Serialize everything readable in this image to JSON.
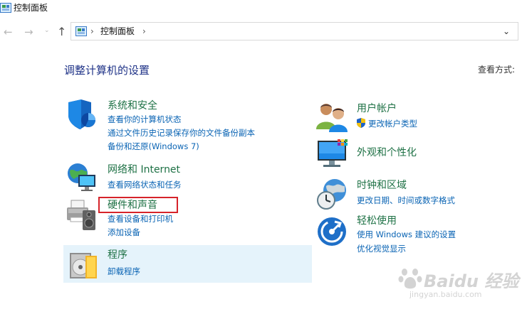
{
  "window": {
    "title": "控制面板",
    "icon": "control-panel-icon"
  },
  "address_bar": {
    "back_icon": "←",
    "forward_icon": "→",
    "recent_icon": "⌄",
    "up_icon": "↑",
    "separator": "›",
    "breadcrumb": "控制面板",
    "dropdown_icon": "⌄"
  },
  "page": {
    "title": "调整计算机的设置",
    "view_by_label": "查看方式:"
  },
  "categories_left": [
    {
      "title": "系统和安全",
      "icon": "shield-icon",
      "links": [
        "查看你的计算机状态",
        "通过文件历史记录保存你的文件备份副本",
        "备份和还原(Windows 7)"
      ]
    },
    {
      "title": "网络和 Internet",
      "icon": "network-globe-icon",
      "links": [
        "查看网络状态和任务"
      ]
    },
    {
      "title": "硬件和声音",
      "icon": "printer-speaker-icon",
      "links": [
        "查看设备和打印机",
        "添加设备"
      ]
    },
    {
      "title": "程序",
      "icon": "programs-disc-icon",
      "links": [
        "卸载程序"
      ]
    }
  ],
  "categories_right": [
    {
      "title": "用户帐户",
      "icon": "users-icon",
      "links": [
        "更改帐户类型"
      ]
    },
    {
      "title": "外观和个性化",
      "icon": "monitor-palette-icon",
      "links": []
    },
    {
      "title": "时钟和区域",
      "icon": "clock-globe-icon",
      "links": [
        "更改日期、时间或数字格式"
      ]
    },
    {
      "title": "轻松使用",
      "icon": "ease-of-access-icon",
      "links": [
        "使用 Windows 建议的设置",
        "优化视觉显示"
      ]
    }
  ],
  "watermark": {
    "text": "Baidu 经验",
    "url": "jingyan.baidu.com"
  },
  "colors": {
    "category_title": "#1e7145",
    "link": "#0a64b4",
    "heading": "#1e3287",
    "highlight_box": "#d6232a",
    "hover_bg": "#e5f3fb"
  }
}
